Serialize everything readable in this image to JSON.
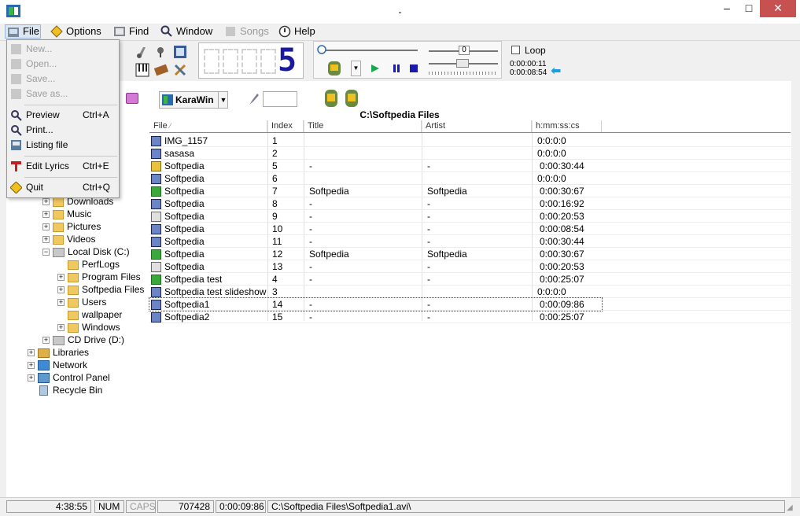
{
  "window": {
    "title": "-",
    "minimize": "–",
    "maximize": "□",
    "close": "✕"
  },
  "menubar": {
    "items": [
      {
        "label": "File",
        "icon": "file-icon"
      },
      {
        "label": "Options",
        "icon": "options-icon"
      },
      {
        "label": "Find",
        "icon": "find-icon"
      },
      {
        "label": "Window",
        "icon": "window-icon"
      },
      {
        "label": "Songs",
        "icon": "songs-icon"
      },
      {
        "label": "Help",
        "icon": "help-icon"
      }
    ]
  },
  "file_menu": {
    "items": [
      {
        "label": "New...",
        "shortcut": "",
        "enabled": false
      },
      {
        "label": "Open...",
        "shortcut": "",
        "enabled": false
      },
      {
        "label": "Save...",
        "shortcut": "",
        "enabled": false
      },
      {
        "label": "Save as...",
        "shortcut": "",
        "enabled": false
      },
      {
        "label": "Preview",
        "shortcut": "Ctrl+A",
        "enabled": true
      },
      {
        "label": "Print...",
        "shortcut": "",
        "enabled": true
      },
      {
        "label": "Listing file",
        "shortcut": "",
        "enabled": true
      },
      {
        "label": "Edit Lyrics",
        "shortcut": "Ctrl+E",
        "enabled": true
      },
      {
        "label": "Quit",
        "shortcut": "Ctrl+Q",
        "enabled": true
      }
    ]
  },
  "player": {
    "lcd_digit": "5",
    "volume_value": "0",
    "loop_label": "Loop",
    "loop_checked": false,
    "time_position": "0:00:00:11",
    "time_total": "0:00:08:54"
  },
  "playlist": {
    "selector_label": "KaraWin",
    "search_value": "",
    "path": "C:\\Softpedia Files"
  },
  "tree": {
    "items": [
      {
        "label": "Downloads",
        "type": "folder"
      },
      {
        "label": "Music",
        "type": "folder"
      },
      {
        "label": "Pictures",
        "type": "folder"
      },
      {
        "label": "Videos",
        "type": "folder"
      },
      {
        "label": "Local Disk (C:)",
        "type": "drive"
      },
      {
        "label": "PerfLogs",
        "type": "folder"
      },
      {
        "label": "Program Files",
        "type": "folder"
      },
      {
        "label": "Softpedia Files",
        "type": "folder"
      },
      {
        "label": "Users",
        "type": "folder"
      },
      {
        "label": "wallpaper",
        "type": "folder"
      },
      {
        "label": "Windows",
        "type": "folder"
      },
      {
        "label": "CD Drive (D:)",
        "type": "drive"
      },
      {
        "label": "Libraries",
        "type": "libraries"
      },
      {
        "label": "Network",
        "type": "network"
      },
      {
        "label": "Control Panel",
        "type": "control-panel"
      },
      {
        "label": "Recycle Bin",
        "type": "recycle-bin"
      }
    ]
  },
  "table": {
    "columns": [
      "File",
      "Index",
      "Title",
      "Artist",
      "h:mm:ss:cs"
    ],
    "rows": [
      {
        "file": "IMG_1157",
        "index": "1",
        "title": "",
        "artist": "",
        "time": "0:0:0:0",
        "icon": "video"
      },
      {
        "file": "sasasa",
        "index": "2",
        "title": "",
        "artist": "",
        "time": "0:0:0:0",
        "icon": "video"
      },
      {
        "file": "Softpedia",
        "index": "5",
        "title": "-",
        "artist": "-",
        "time": "0:00:30:44",
        "icon": "lyrics"
      },
      {
        "file": "Softpedia",
        "index": "6",
        "title": "",
        "artist": "",
        "time": "0:0:0:0",
        "icon": "video"
      },
      {
        "file": "Softpedia",
        "index": "7",
        "title": "Softpedia",
        "artist": "Softpedia",
        "time": "0:00:30:67",
        "icon": "karaoke"
      },
      {
        "file": "Softpedia",
        "index": "8",
        "title": "-",
        "artist": "-",
        "time": "0:00:16:92",
        "icon": "video"
      },
      {
        "file": "Softpedia",
        "index": "9",
        "title": "-",
        "artist": "-",
        "time": "0:00:20:53",
        "icon": "midi"
      },
      {
        "file": "Softpedia",
        "index": "10",
        "title": "-",
        "artist": "-",
        "time": "0:00:08:54",
        "icon": "video"
      },
      {
        "file": "Softpedia",
        "index": "11",
        "title": "-",
        "artist": "-",
        "time": "0:00:30:44",
        "icon": "video"
      },
      {
        "file": "Softpedia",
        "index": "12",
        "title": "Softpedia",
        "artist": "Softpedia",
        "time": "0:00:30:67",
        "icon": "karaoke"
      },
      {
        "file": "Softpedia",
        "index": "13",
        "title": "-",
        "artist": "-",
        "time": "0:00:20:53",
        "icon": "midi"
      },
      {
        "file": "Softpedia test",
        "index": "4",
        "title": "-",
        "artist": "-",
        "time": "0:00:25:07",
        "icon": "karaoke"
      },
      {
        "file": "Softpedia test slideshow",
        "index": "3",
        "title": "",
        "artist": "",
        "time": "0:0:0:0",
        "icon": "video"
      },
      {
        "file": "Softpedia1",
        "index": "14",
        "title": "-",
        "artist": "-",
        "time": "0:00:09:86",
        "icon": "video",
        "selected": true
      },
      {
        "file": "Softpedia2",
        "index": "15",
        "title": "-",
        "artist": "-",
        "time": "0:00:25:07",
        "icon": "video"
      }
    ]
  },
  "status": {
    "clock": "4:38:55",
    "num": "NUM",
    "caps": "CAPS",
    "value": "707428",
    "duration": "0:00:09:86",
    "path": "C:\\Softpedia Files\\Softpedia1.avi\\"
  },
  "colors": {
    "accent": "#1a1aa0",
    "selection": "#dde7f3",
    "close": "#c75050"
  }
}
